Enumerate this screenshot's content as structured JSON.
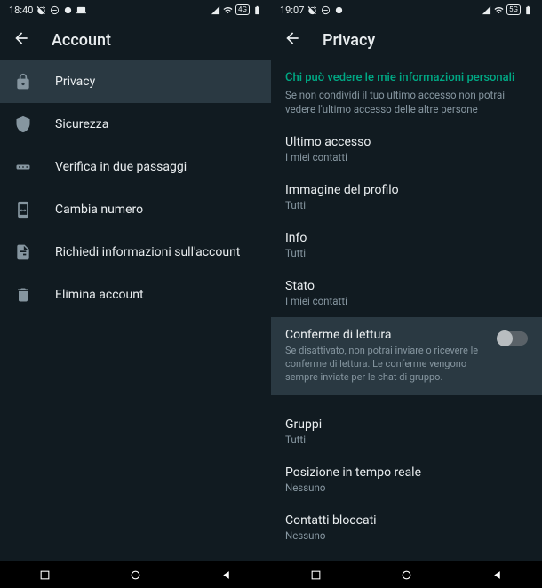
{
  "left": {
    "status": {
      "time": "18:40",
      "network": "4G"
    },
    "header": {
      "title": "Account"
    },
    "menu": [
      {
        "label": "Privacy"
      },
      {
        "label": "Sicurezza"
      },
      {
        "label": "Verifica in due passaggi"
      },
      {
        "label": "Cambia numero"
      },
      {
        "label": "Richiedi informazioni sull'account"
      },
      {
        "label": "Elimina account"
      }
    ]
  },
  "right": {
    "status": {
      "time": "19:07",
      "network": "5G"
    },
    "header": {
      "title": "Privacy"
    },
    "section": {
      "title": "Chi può vedere le mie informazioni personali",
      "desc": "Se non condividi il tuo ultimo accesso non potrai vedere l'ultimo accesso delle altre persone"
    },
    "settings": {
      "ultimo": {
        "title": "Ultimo accesso",
        "value": "I miei contatti"
      },
      "profilo": {
        "title": "Immagine del profilo",
        "value": "Tutti"
      },
      "info": {
        "title": "Info",
        "value": "Tutti"
      },
      "stato": {
        "title": "Stato",
        "value": "I miei contatti"
      },
      "conferme": {
        "title": "Conferme di lettura",
        "desc": "Se disattivato, non potrai inviare o ricevere le conferme di lettura. Le conferme vengono sempre inviate per le chat di gruppo."
      },
      "gruppi": {
        "title": "Gruppi",
        "value": "Tutti"
      },
      "posizione": {
        "title": "Posizione in tempo reale",
        "value": "Nessuno"
      },
      "contatti": {
        "title": "Contatti bloccati",
        "value": "Nessuno"
      }
    }
  }
}
